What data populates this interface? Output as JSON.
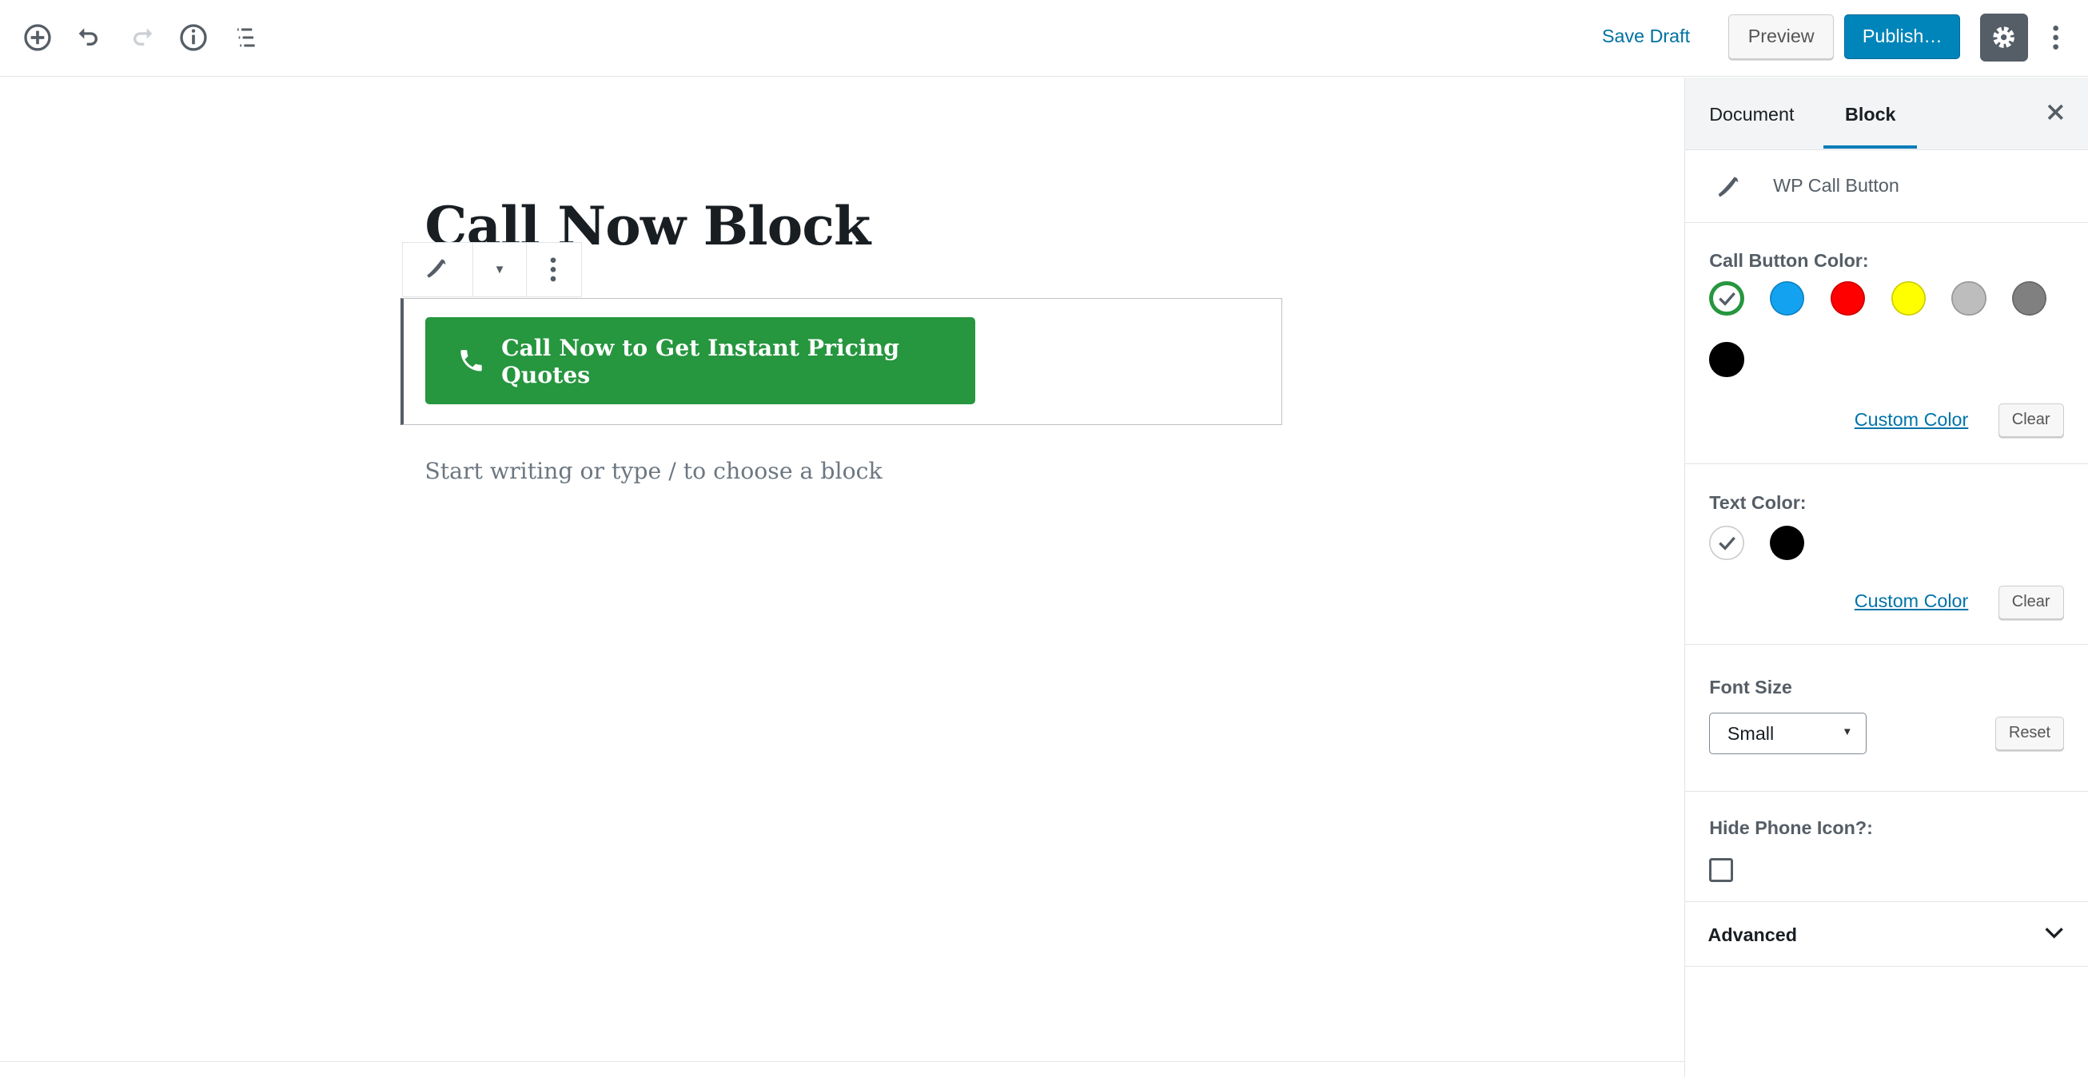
{
  "topbar": {
    "save_draft": "Save Draft",
    "preview": "Preview",
    "publish": "Publish…"
  },
  "editor": {
    "title": "Call Now Block",
    "button_text": "Call Now to Get Instant Pricing Quotes",
    "placeholder": "Start writing or type / to choose a block",
    "button_color": "#26963f"
  },
  "sidebar": {
    "tabs": [
      {
        "label": "Document"
      },
      {
        "label": "Block"
      }
    ],
    "block_name": "WP Call Button",
    "call_button_color": {
      "label": "Call Button Color:",
      "colors": [
        "#26963f",
        "#12a2f0",
        "#ff0000",
        "#ffff00",
        "#bdbdbd",
        "#808080",
        "#000000"
      ],
      "selected": "#26963f",
      "custom": "Custom Color",
      "clear": "Clear"
    },
    "text_color": {
      "label": "Text Color:",
      "colors": [
        "#ffffff",
        "#000000"
      ],
      "selected": "#ffffff",
      "custom": "Custom Color",
      "clear": "Clear"
    },
    "font_size": {
      "label": "Font Size",
      "value": "Small",
      "reset": "Reset"
    },
    "hide_icon": {
      "label": "Hide Phone Icon?:",
      "checked": false
    },
    "advanced": "Advanced"
  }
}
